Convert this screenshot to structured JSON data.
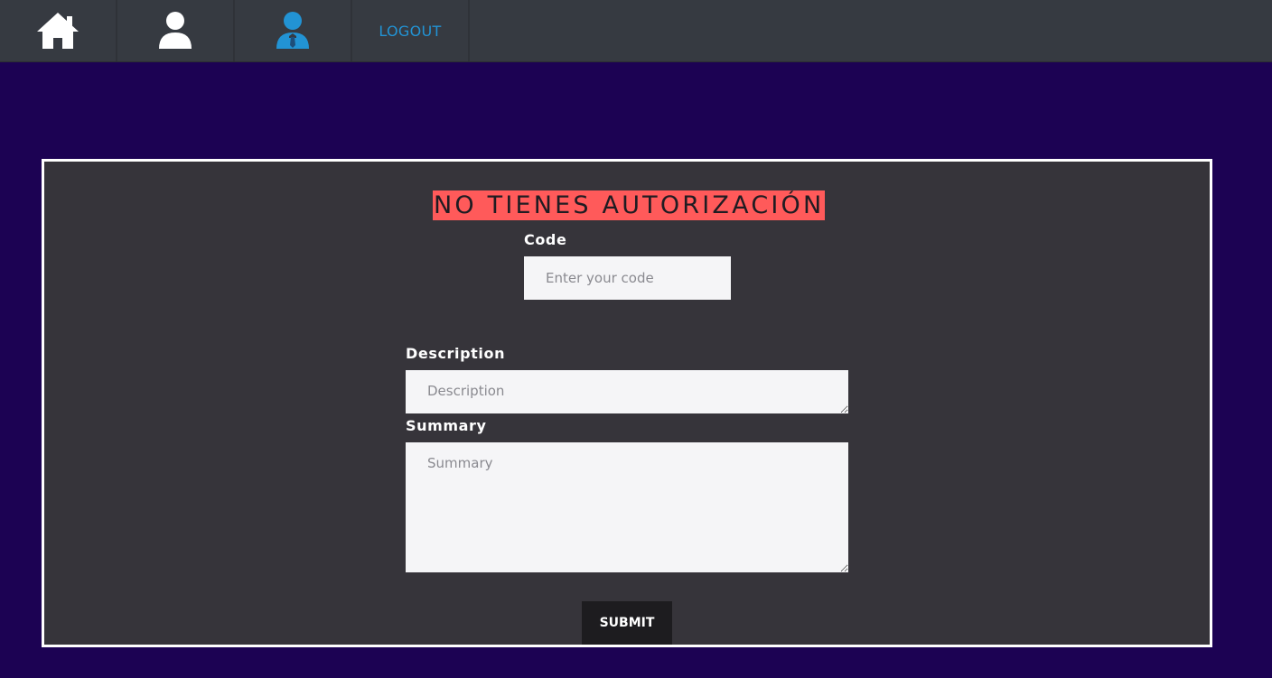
{
  "nav": {
    "items": [
      {
        "icon": "home-icon",
        "color": "#ffffff"
      },
      {
        "icon": "user-icon",
        "color": "#ffffff"
      },
      {
        "icon": "business-user-icon",
        "color": "#2293d4"
      }
    ],
    "logout_label": "LOGOUT"
  },
  "form": {
    "error_message": "NO TIENES AUTORIZACIÓN",
    "code_label": "Code",
    "code_placeholder": "Enter your code",
    "code_value": "",
    "description_label": "Description",
    "description_placeholder": "Description",
    "description_value": "",
    "summary_label": "Summary",
    "summary_placeholder": "Summary",
    "summary_value": "",
    "submit_label": "SUBMIT"
  },
  "colors": {
    "page_background": "#1c0253",
    "navbar": "#363a41",
    "panel": "#36343a",
    "error_banner": "#ff5a5a",
    "accent": "#2293d4"
  }
}
